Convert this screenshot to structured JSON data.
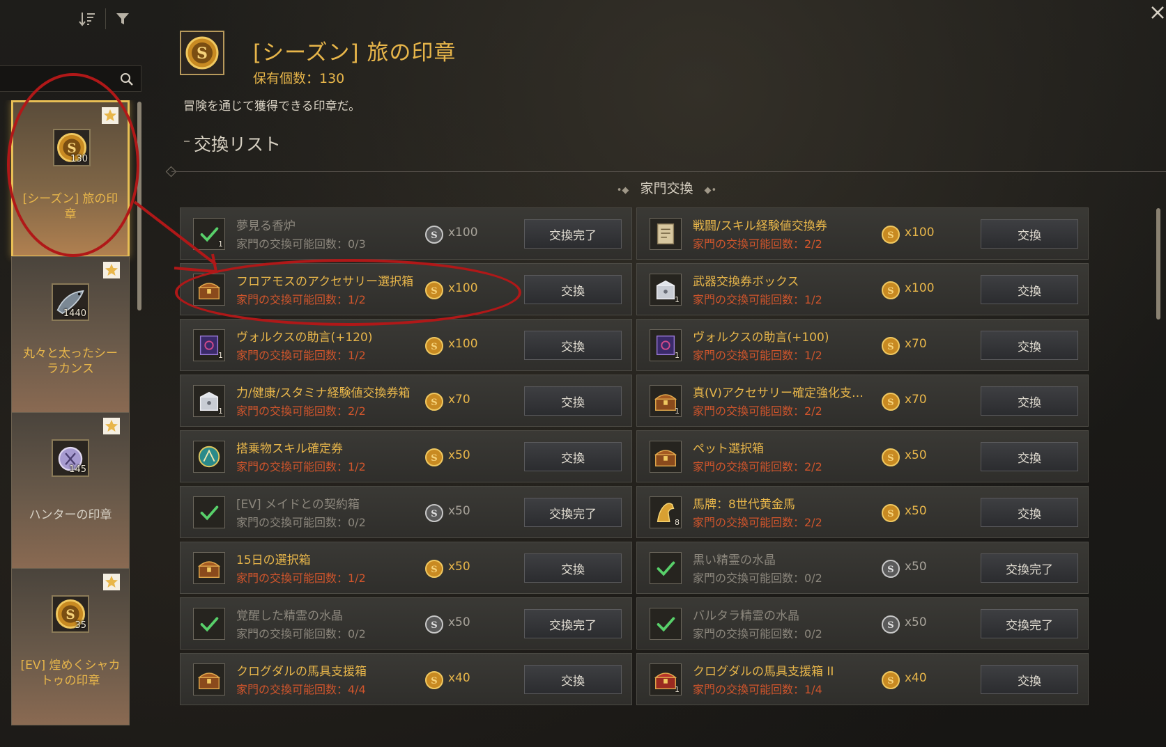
{
  "toolbar": {
    "sort_icon": "sort-icon",
    "filter_icon": "filter-icon",
    "close_icon": "close-icon"
  },
  "search": {
    "value": "",
    "placeholder": ""
  },
  "sidebar": {
    "cards": [
      {
        "label": "[シーズン] 旅の印章",
        "count": "130",
        "selected": true,
        "icon": "season-seal-coin-icon"
      },
      {
        "label": "丸々と太ったシーラカンス",
        "count": "1440",
        "selected": false,
        "icon": "coelacanth-fish-icon"
      },
      {
        "label": "ハンターの印章",
        "count": "145",
        "selected": false,
        "icon": "hunter-seal-icon"
      },
      {
        "label": "[EV] 煌めくシャカトゥの印章",
        "count": "35",
        "selected": false,
        "icon": "shakatu-seal-coin-icon"
      }
    ]
  },
  "header": {
    "title": "[シーズン] 旅の印章",
    "held_count": "保有個数：130",
    "description": "冒険を通じて獲得できる印章だ。",
    "section_title": "交換リスト",
    "subheader": "家門交換"
  },
  "exchange": {
    "left": [
      {
        "name": "夢見る香炉",
        "quota": "家門の交換可能回数：0/3",
        "cost": "x100",
        "button": "交換完了",
        "done": true,
        "qty": "1",
        "icon": "checkmark-icon"
      },
      {
        "name": "フロアモスのアクセサリー選択箱",
        "quota": "家門の交換可能回数：1/2",
        "cost": "x100",
        "button": "交換",
        "done": false,
        "qty": "",
        "icon": "treasure-chest-icon"
      },
      {
        "name": "ヴォルクスの助言(+120)",
        "quota": "家門の交換可能回数：1/2",
        "cost": "x100",
        "button": "交換",
        "done": false,
        "qty": "1",
        "icon": "scroll-icon"
      },
      {
        "name": "力/健康/スタミナ経験値交換券箱",
        "quota": "家門の交換可能回数：2/2",
        "cost": "x70",
        "button": "交換",
        "done": false,
        "qty": "1",
        "icon": "silver-box-icon"
      },
      {
        "name": "搭乗物スキル確定券",
        "quota": "家門の交換可能回数：1/2",
        "cost": "x50",
        "button": "交換",
        "done": false,
        "qty": "",
        "icon": "mount-skill-icon"
      },
      {
        "name": "[EV] メイドとの契約箱",
        "quota": "家門の交換可能回数：0/2",
        "cost": "x50",
        "button": "交換完了",
        "done": true,
        "qty": "",
        "icon": "checkmark-icon"
      },
      {
        "name": "15日の選択箱",
        "quota": "家門の交換可能回数：1/2",
        "cost": "x50",
        "button": "交換",
        "done": false,
        "qty": "",
        "icon": "treasure-chest-icon"
      },
      {
        "name": "覚醒した精霊の水晶",
        "quota": "家門の交換可能回数：0/2",
        "cost": "x50",
        "button": "交換完了",
        "done": true,
        "qty": "",
        "icon": "checkmark-icon"
      },
      {
        "name": "クログダルの馬具支援箱",
        "quota": "家門の交換可能回数：4/4",
        "cost": "x40",
        "button": "交換",
        "done": false,
        "qty": "",
        "icon": "treasure-chest-icon"
      }
    ],
    "right": [
      {
        "name": "戦闘/スキル経験値交換券",
        "quota": "家門の交換可能回数：2/2",
        "cost": "x100",
        "button": "交換",
        "done": false,
        "qty": "",
        "icon": "ticket-icon"
      },
      {
        "name": "武器交換券ボックス",
        "quota": "家門の交換可能回数：1/2",
        "cost": "x100",
        "button": "交換",
        "done": false,
        "qty": "1",
        "icon": "silver-box-icon"
      },
      {
        "name": "ヴォルクスの助言(+100)",
        "quota": "家門の交換可能回数：1/2",
        "cost": "x70",
        "button": "交換",
        "done": false,
        "qty": "1",
        "icon": "scroll-icon"
      },
      {
        "name": "真(V)アクセサリー確定強化支…",
        "quota": "家門の交換可能回数：2/2",
        "cost": "x70",
        "button": "交換",
        "done": false,
        "qty": "1",
        "icon": "treasure-chest-icon"
      },
      {
        "name": "ペット選択箱",
        "quota": "家門の交換可能回数：2/2",
        "cost": "x50",
        "button": "交換",
        "done": false,
        "qty": "",
        "icon": "treasure-chest-icon"
      },
      {
        "name": "馬牌：8世代黄金馬",
        "quota": "家門の交換可能回数：2/2",
        "cost": "x50",
        "button": "交換",
        "done": false,
        "qty": "8",
        "icon": "golden-horse-icon"
      },
      {
        "name": "黒い精霊の水晶",
        "quota": "家門の交換可能回数：0/2",
        "cost": "x50",
        "button": "交換完了",
        "done": true,
        "qty": "",
        "icon": "checkmark-icon"
      },
      {
        "name": "バルタラ精霊の水晶",
        "quota": "家門の交換可能回数：0/2",
        "cost": "x50",
        "button": "交換完了",
        "done": true,
        "qty": "",
        "icon": "checkmark-icon"
      },
      {
        "name": "クログダルの馬具支援箱 II",
        "quota": "家門の交換可能回数：1/4",
        "cost": "x40",
        "button": "交換",
        "done": false,
        "qty": "1",
        "icon": "red-chest-icon"
      }
    ]
  },
  "colors": {
    "accent_gold": "#e8b64a",
    "quota_red": "#d0552c",
    "done_gray": "#8c877d",
    "annotation_red": "#b01818"
  }
}
